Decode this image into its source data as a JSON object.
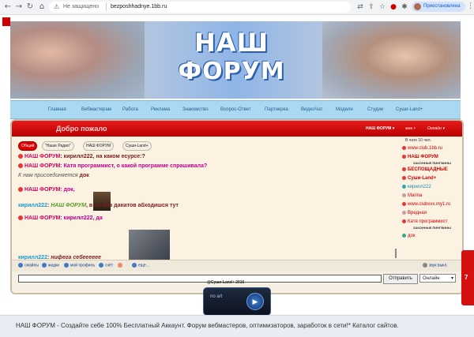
{
  "browser": {
    "security_label": "Не защищено",
    "url": "bezposhhadnye.1bb.ru",
    "profile_label": "Приостановлена"
  },
  "site": {
    "logo_line1": "НАШ",
    "logo_line2": "ФОРУМ"
  },
  "menu": [
    "Главная",
    "Вебмастерам",
    "Работа",
    "Реклама",
    "Знакомство",
    "Вопрос-Ответ",
    "Партнерка",
    "ВидеоЧат",
    "Модели",
    "Студии",
    "Суши-Land+"
  ],
  "chat": {
    "welcome": "Добро пожало",
    "header_right": [
      "НАШ ФОРУМ ▾",
      "■■■ ▾",
      "Онлайн ▾"
    ],
    "tabs": [
      "Общий",
      "\"Наше Радио\"",
      "НАШ ФОРУМ",
      "Суши-Land+"
    ],
    "active_tab": 0,
    "messages": [
      {
        "name": "НАШ ФОРУМ",
        "text": "кирилл222, на каком есурсе:?"
      },
      {
        "name": "НАШ ФОРУМ",
        "text": "Катя программист, о какой программе спрашивала?"
      },
      {
        "system": "К нам присоединяется",
        "who": "док"
      },
      {
        "name": "НАШ ФОРУМ",
        "text": "док,"
      },
      {
        "name": "кирилл222",
        "mention": "НАШ ФОРУМ",
        "text": ", в ты без данатов абходишся тут"
      },
      {
        "name": "НАШ ФОРУМ",
        "text": "кирилл222, да"
      },
      {
        "name": "кирилл222",
        "text": "нифега себееееее"
      }
    ],
    "users_count": "В чате 10 чел.",
    "users": [
      {
        "name": "www.club.1bb.ru"
      },
      {
        "name": "НАШ ФОРУМ",
        "tag": "ЗАКОННЫЕ ПИНГВИНЫ"
      },
      {
        "name": "БЕСПОЩАДНЫЕ"
      },
      {
        "name": "Суши-Land+"
      },
      {
        "name": "кирилл222"
      },
      {
        "name": "Marina"
      },
      {
        "name": "www.clubxxx.my1.ru"
      },
      {
        "name": "Вредная"
      },
      {
        "name": "Катя программист",
        "tag": "ЗАКОННЫЕ ПИНГВИНЫ"
      },
      {
        "name": "док"
      }
    ],
    "footer_buttons": [
      "смайлы",
      "жидки",
      "мой профиль",
      "счёт",
      "",
      "еще..."
    ],
    "footer_right": "звук выкл.",
    "send_label": "Отправить",
    "status_value": "Онлайн"
  },
  "copyright": "@Суши Land+ 2016",
  "radio": {
    "display": "no art"
  },
  "side_tab": "7",
  "footer_text": "НАШ ФОРУМ - Создайте себе 100% Бесплатный Аккаунт. Форум вебмастеров, оптимизаторов, заработок в сети!* Каталог сайтов."
}
